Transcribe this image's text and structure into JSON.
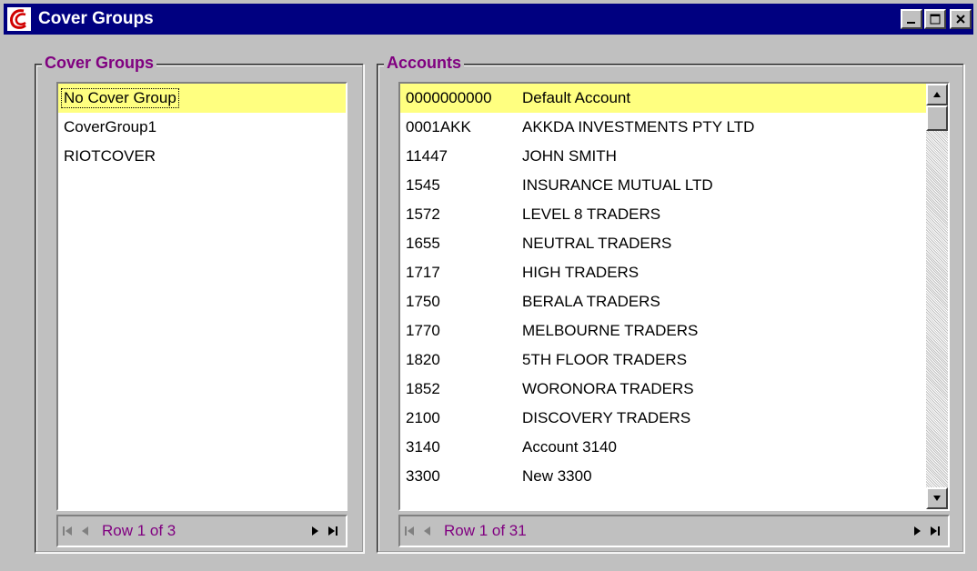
{
  "window": {
    "title": "Cover Groups",
    "minimize_label": "_",
    "maximize_label": "□",
    "close_label": "×"
  },
  "cover_groups": {
    "label": "Cover Groups",
    "items": [
      {
        "label": "No Cover Group",
        "selected": true
      },
      {
        "label": "CoverGroup1",
        "selected": false
      },
      {
        "label": "RIOTCOVER",
        "selected": false
      }
    ],
    "nav_text": "Row 1 of 3"
  },
  "accounts": {
    "label": "Accounts",
    "rows": [
      {
        "code": "0000000000",
        "name": "Default Account",
        "selected": true
      },
      {
        "code": "0001AKK",
        "name": "AKKDA  INVESTMENTS PTY LTD"
      },
      {
        "code": "11447",
        "name": "JOHN SMITH"
      },
      {
        "code": "1545",
        "name": "INSURANCE MUTUAL LTD"
      },
      {
        "code": "1572",
        "name": "LEVEL 8 TRADERS"
      },
      {
        "code": "1655",
        "name": "NEUTRAL TRADERS"
      },
      {
        "code": "1717",
        "name": "HIGH TRADERS"
      },
      {
        "code": "1750",
        "name": "BERALA TRADERS"
      },
      {
        "code": "1770",
        "name": "MELBOURNE TRADERS"
      },
      {
        "code": "1820",
        "name": "5TH FLOOR TRADERS"
      },
      {
        "code": "1852",
        "name": "WORONORA TRADERS"
      },
      {
        "code": "2100",
        "name": "DISCOVERY TRADERS"
      },
      {
        "code": "3140",
        "name": "Account 3140"
      },
      {
        "code": "3300",
        "name": "New 3300"
      }
    ],
    "nav_text": "Row 1 of 31"
  },
  "colors": {
    "titlebar": "#000080",
    "selection": "#ffff80",
    "group_label": "#800080"
  },
  "icons": {
    "app": "app-logo-icon",
    "first": "first-record-icon",
    "prev": "previous-record-icon",
    "next": "next-record-icon",
    "last": "last-record-icon"
  }
}
